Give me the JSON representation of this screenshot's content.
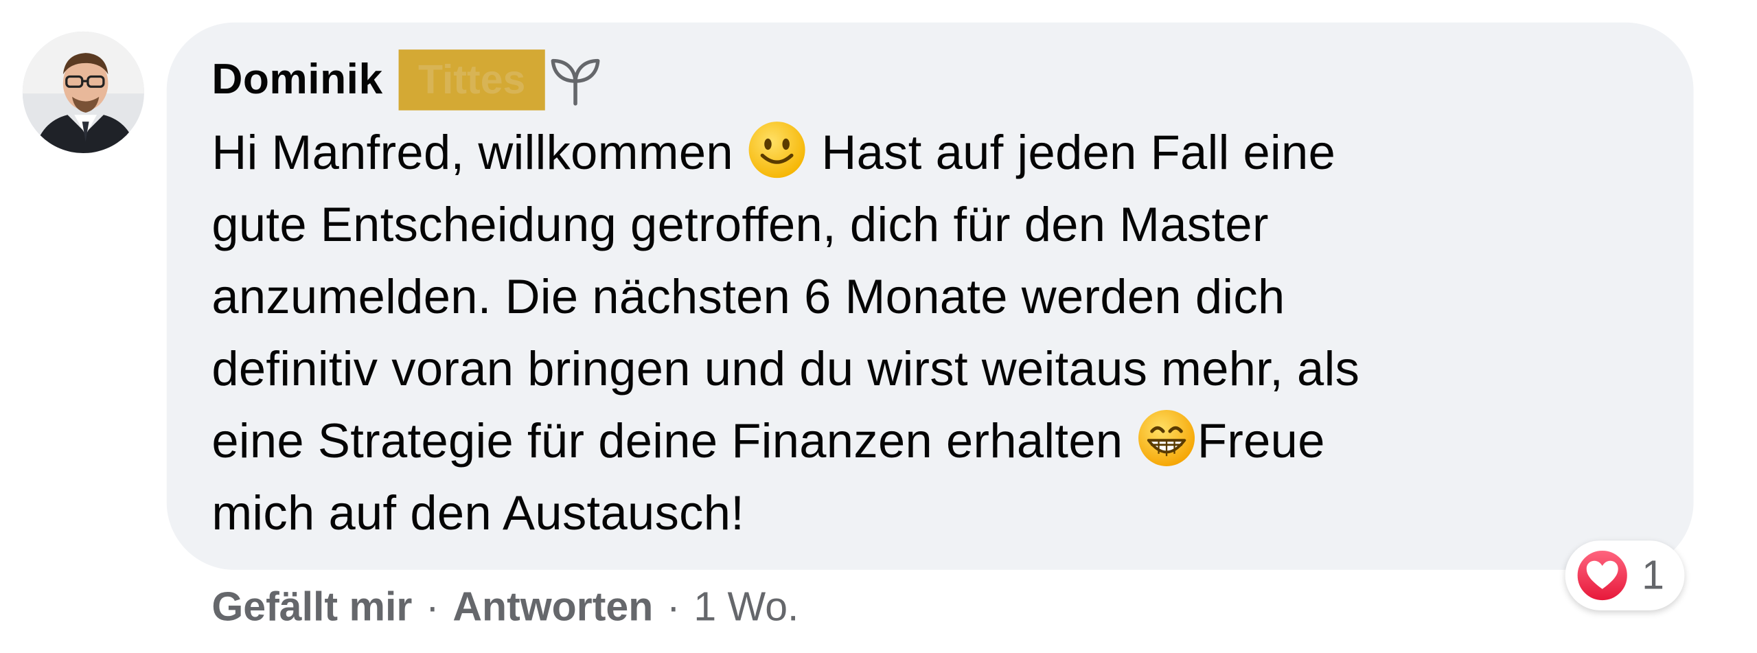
{
  "comment": {
    "author_first": "Dominik",
    "author_last_redacted": "Tittes",
    "author_badge_icon": "sprout-icon",
    "text_lines": [
      [
        "Hi Manfred, willkommen ",
        "smile-emoji",
        " Hast auf jeden Fall eine"
      ],
      [
        "gute Entscheidung getroffen, dich für den Master"
      ],
      [
        "anzumelden. Die nächsten 6 Monate werden dich"
      ],
      [
        "definitiv voran bringen und du wirst weitaus mehr, als"
      ],
      [
        "eine Strategie für deine Finanzen erhalten ",
        "grin-emoji",
        "Freue"
      ],
      [
        "mich auf den Austausch!"
      ]
    ],
    "line1": {
      "before": "Hi Manfred, willkommen ",
      "after": " Hast auf jeden Fall eine"
    },
    "line2": "gute Entscheidung getroffen, dich für den Master",
    "line3": "anzumelden. Die nächsten 6 Monate werden dich",
    "line4": "definitiv voran bringen und du wirst weitaus mehr, als",
    "line5": {
      "before": "eine Strategie für deine Finanzen erhalten ",
      "after": "Freue"
    },
    "line6": "mich auf den Austausch!"
  },
  "actions": {
    "like": "Gefällt mir",
    "sep1": "·",
    "reply": "Antworten",
    "sep2": "·",
    "time": "1 Wo."
  },
  "reaction": {
    "icon": "heart-icon",
    "count": "1"
  },
  "colors": {
    "bubble_bg": "#f0f2f5",
    "redaction": "#d4a934",
    "text": "#050505",
    "secondary": "#65676b",
    "heart": "#f33e58"
  }
}
